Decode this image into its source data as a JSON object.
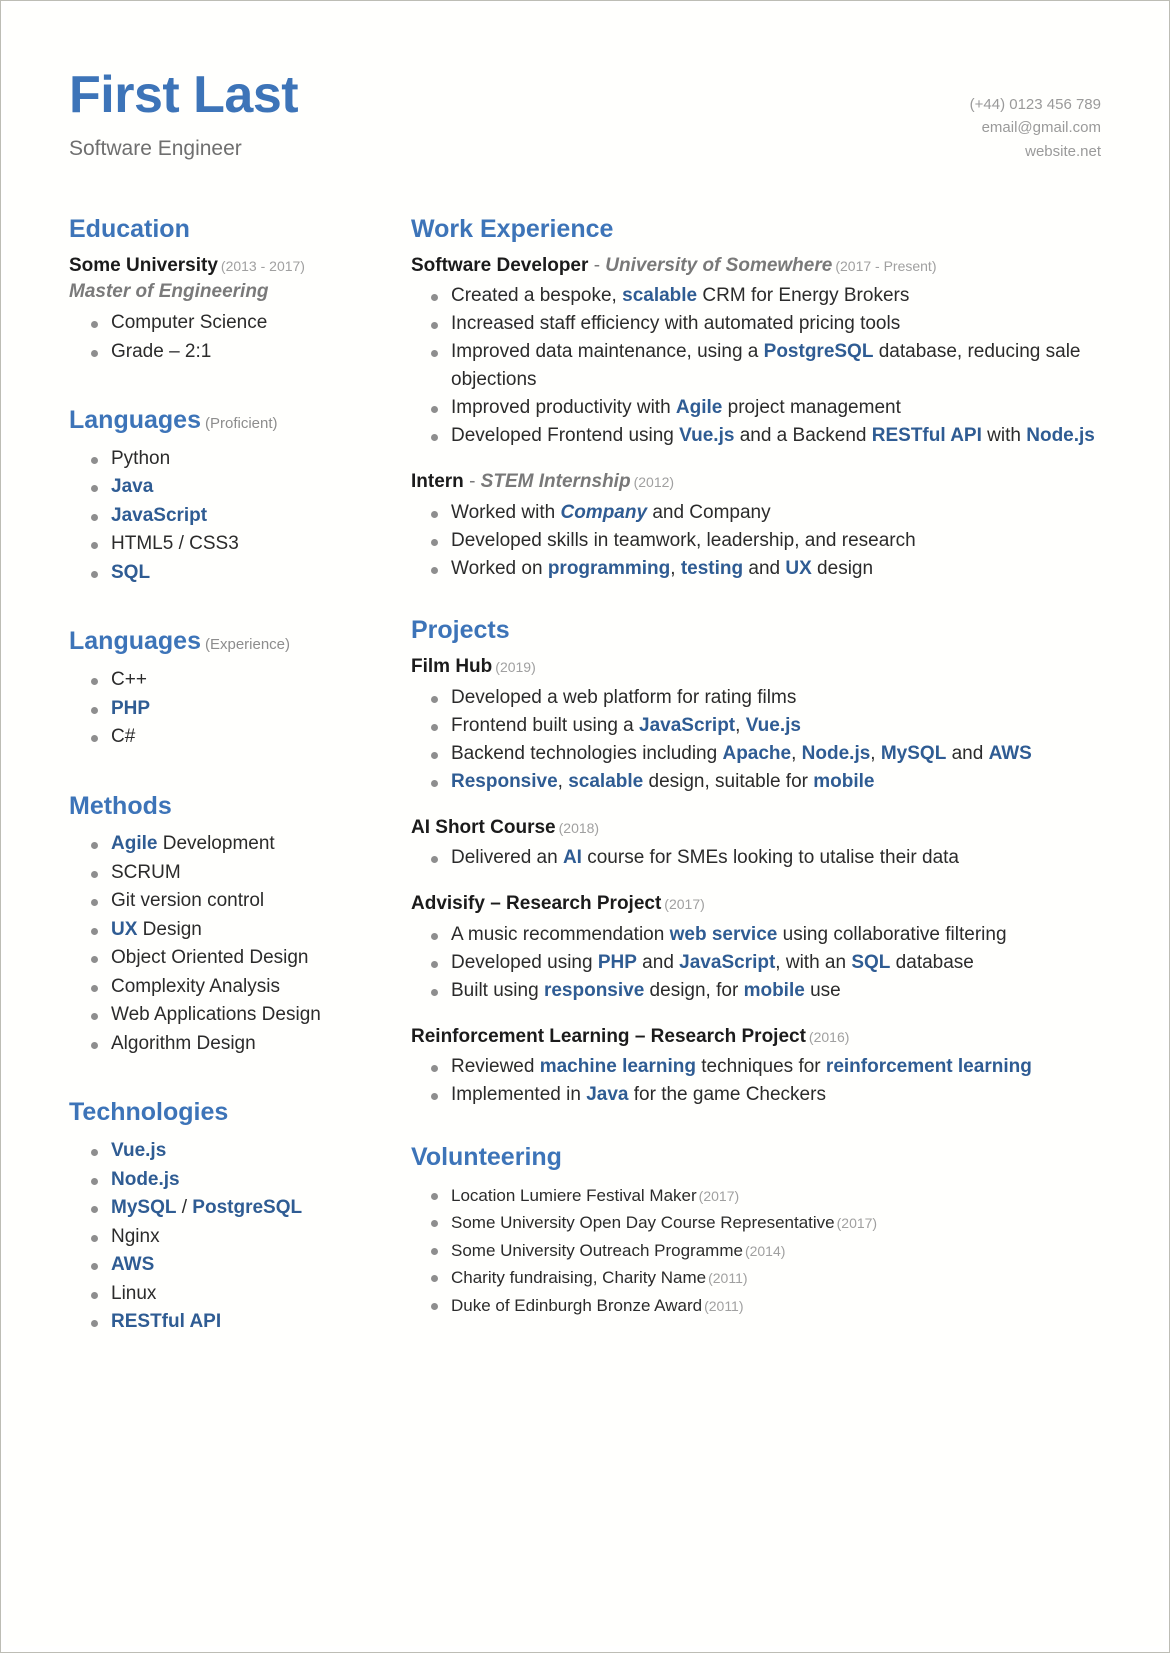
{
  "colors": {
    "accent": "#3d74b8",
    "keyword": "#2f5c93",
    "muted": "#9a9a9a",
    "text": "#2b2b2b"
  },
  "header": {
    "name": "First Last",
    "subtitle": "Software Engineer",
    "contact": {
      "phone": "(+44) 0123 456 789",
      "email": "email@gmail.com",
      "website": "website.net"
    }
  },
  "left": {
    "education": {
      "heading": "Education",
      "school": "Some University",
      "school_years": "(2013 - 2017)",
      "degree": "Master of Engineering",
      "items": [
        "Computer Science",
        "Grade – 2:1"
      ]
    },
    "languages_proficient": {
      "heading": "Languages",
      "qualifier": "(Proficient)",
      "items": [
        "Python",
        "Java",
        "JavaScript",
        "HTML5 / CSS3",
        "SQL"
      ]
    },
    "languages_experience": {
      "heading": "Languages",
      "qualifier": "(Experience)",
      "items": [
        "C++",
        "PHP",
        "C#"
      ]
    },
    "methods": {
      "heading": "Methods",
      "items": [
        "Agile Development",
        "SCRUM",
        "Git version control",
        "UX Design",
        "Object Oriented Design",
        "Complexity Analysis",
        "Web Applications Design",
        "Algorithm Design"
      ]
    },
    "technologies": {
      "heading": "Technologies",
      "items": [
        "Vue.js",
        "Node.js",
        "MySQL / PostgreSQL",
        "Nginx",
        "AWS",
        "Linux",
        "RESTful API"
      ]
    }
  },
  "right": {
    "work": {
      "heading": "Work Experience",
      "jobs": [
        {
          "role": "Software Developer",
          "separator": "-",
          "org": "University of Somewhere",
          "years": "(2017 - Present)",
          "bullets": [
            "Created a bespoke, scalable CRM for Energy Brokers",
            "Increased staff efficiency with automated pricing tools",
            "Improved data maintenance, using a PostgreSQL database, reducing sale objections",
            "Improved productivity with Agile project management",
            "Developed Frontend using Vue.js and a Backend RESTful API with Node.js"
          ]
        },
        {
          "role": "Intern",
          "separator": "-",
          "org": "STEM Internship",
          "years": "(2012)",
          "bullets": [
            "Worked with Company and Company",
            "Developed skills in teamwork, leadership, and research",
            "Worked on programming, testing and UX design"
          ]
        }
      ]
    },
    "projects": {
      "heading": "Projects",
      "items": [
        {
          "title": "Film Hub",
          "years": "(2019)",
          "bullets": [
            "Developed a web platform for rating films",
            "Frontend built using a JavaScript, Vue.js",
            "Backend technologies including Apache, Node.js, MySQL and AWS",
            "Responsive, scalable design, suitable for mobile"
          ]
        },
        {
          "title": "AI Short Course",
          "years": "(2018)",
          "bullets": [
            "Delivered an AI course for SMEs looking to utalise their data"
          ]
        },
        {
          "title": "Advisify – Research Project",
          "years": "(2017)",
          "bullets": [
            "A music recommendation web service using collaborative filtering",
            "Developed using PHP and JavaScript, with an SQL database",
            "Built using responsive design, for mobile use"
          ]
        },
        {
          "title": "Reinforcement Learning – Research Project",
          "years": "(2016)",
          "bullets": [
            "Reviewed machine learning techniques for reinforcement learning",
            "Implemented in Java for the game Checkers"
          ]
        }
      ]
    },
    "volunteering": {
      "heading": "Volunteering",
      "items": [
        {
          "text": "Location Lumiere Festival Maker",
          "year": "(2017)"
        },
        {
          "text": "Some University Open Day Course Representative",
          "year": "(2017)"
        },
        {
          "text": "Some University Outreach Programme",
          "year": "(2014)"
        },
        {
          "text": "Charity fundraising, Charity Name",
          "year": "(2011)"
        },
        {
          "text": "Duke of Edinburgh Bronze Award",
          "year": "(2011)"
        }
      ]
    }
  },
  "keywords": [
    "PostgreSQL",
    "Agile",
    "Vue.js",
    "RESTful API",
    "Node.js",
    "Apache",
    "MySQL",
    "AWS",
    "JavaScript",
    "Responsive",
    "scalable",
    "AI",
    "web service",
    "PHP",
    "SQL",
    "responsive",
    "mobile",
    "machine learning",
    "reinforcement learning",
    "Java",
    "programming",
    "testing",
    "UX"
  ],
  "italic_keywords": [
    "Company"
  ]
}
